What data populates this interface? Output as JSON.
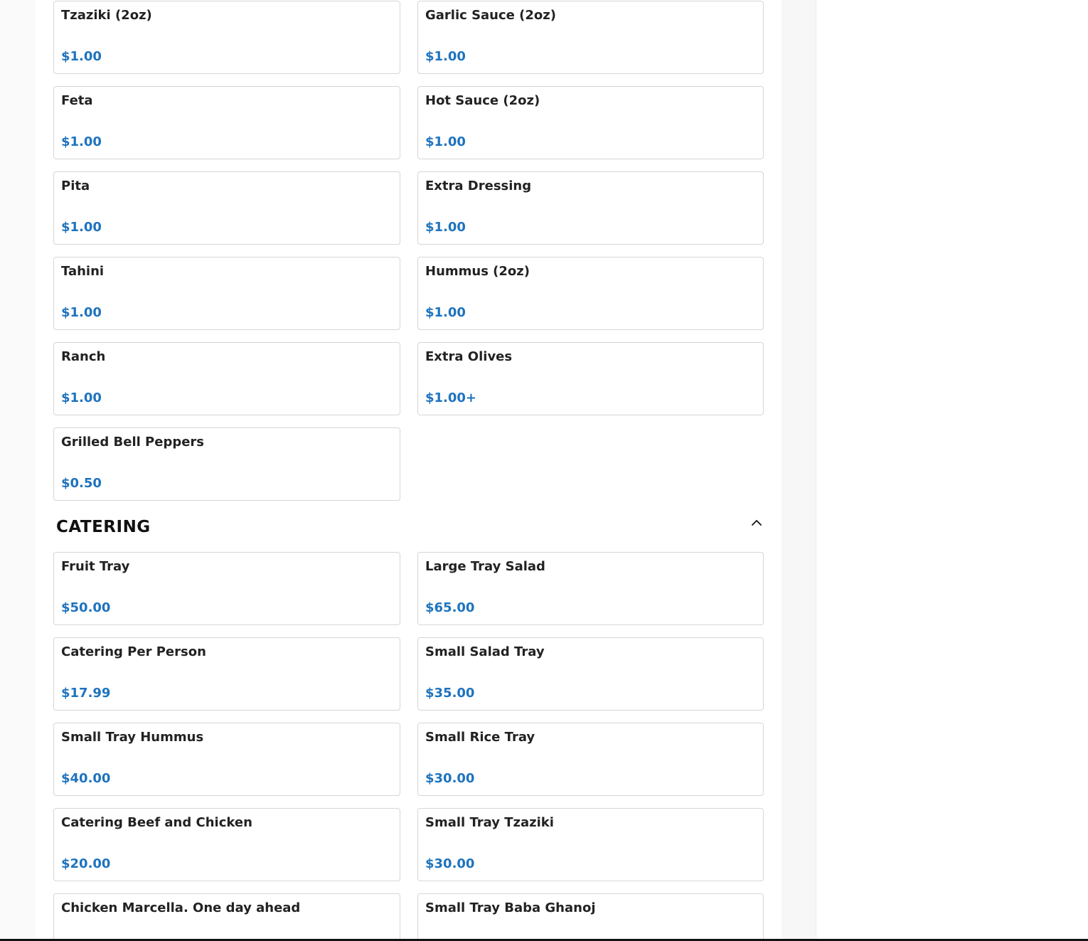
{
  "addons": {
    "items": [
      {
        "name": "Tzaziki (2oz)",
        "price": "$1.00"
      },
      {
        "name": "Garlic Sauce (2oz)",
        "price": "$1.00"
      },
      {
        "name": "Feta",
        "price": "$1.00"
      },
      {
        "name": "Hot Sauce (2oz)",
        "price": "$1.00"
      },
      {
        "name": "Pita",
        "price": "$1.00"
      },
      {
        "name": "Extra Dressing",
        "price": "$1.00"
      },
      {
        "name": "Tahini",
        "price": "$1.00"
      },
      {
        "name": "Hummus (2oz)",
        "price": "$1.00"
      },
      {
        "name": "Ranch",
        "price": "$1.00"
      },
      {
        "name": "Extra Olives",
        "price": "$1.00+"
      },
      {
        "name": "Grilled Bell Peppers",
        "price": "$0.50"
      }
    ]
  },
  "catering": {
    "title": "CATERING",
    "toggle_icon": "chevron-up-icon",
    "items": [
      {
        "name": "Fruit Tray",
        "price": "$50.00"
      },
      {
        "name": "Large Tray Salad",
        "price": "$65.00"
      },
      {
        "name": "Catering Per Person",
        "price": "$17.99"
      },
      {
        "name": "Small Salad Tray",
        "price": "$35.00"
      },
      {
        "name": "Small Tray Hummus",
        "price": "$40.00"
      },
      {
        "name": "Small Rice Tray",
        "price": "$30.00"
      },
      {
        "name": "Catering Beef and Chicken",
        "price": "$20.00"
      },
      {
        "name": "Small Tray Tzaziki",
        "price": "$30.00"
      },
      {
        "name": "Chicken Marcella. One day ahead",
        "price": ""
      },
      {
        "name": "Small Tray Baba Ghanoj",
        "price": ""
      }
    ]
  },
  "colors": {
    "price": "#1e73be",
    "card_border": "#d6d6d6",
    "page_background": "#fafafa"
  }
}
